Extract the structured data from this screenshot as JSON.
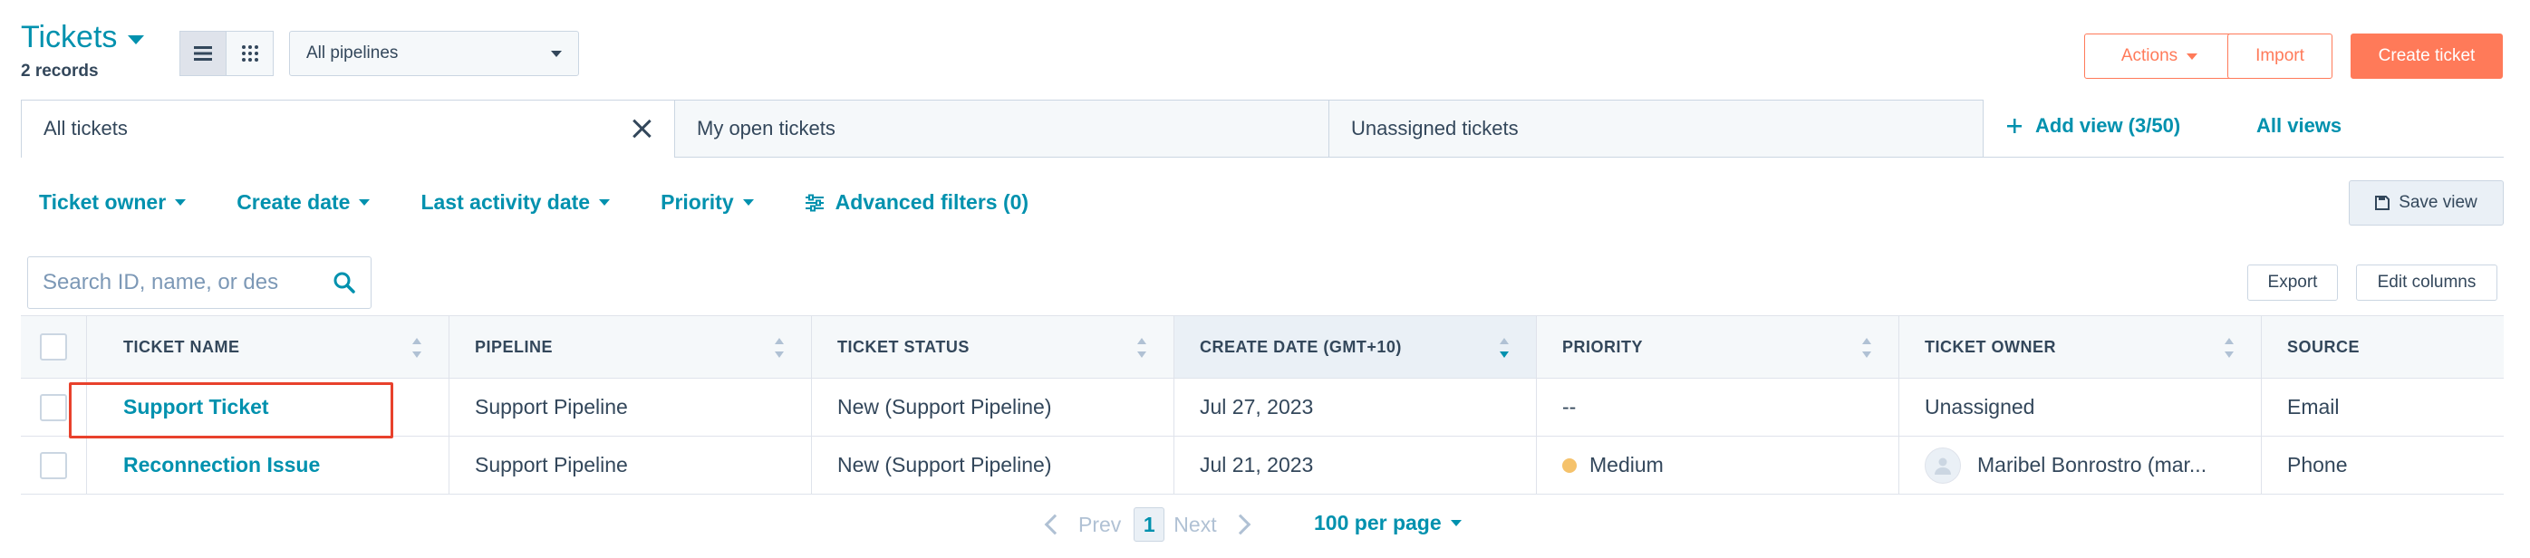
{
  "header": {
    "title": "Tickets",
    "record_count": "2 records",
    "pipeline_select": "All pipelines",
    "actions_label": "Actions",
    "import_label": "Import",
    "create_label": "Create ticket"
  },
  "tabs": [
    {
      "label": "All tickets",
      "active": true
    },
    {
      "label": "My open tickets",
      "active": false
    },
    {
      "label": "Unassigned tickets",
      "active": false
    }
  ],
  "views": {
    "add_view_label": "Add view (3/50)",
    "all_views_label": "All views"
  },
  "filters": {
    "items": [
      "Ticket owner",
      "Create date",
      "Last activity date",
      "Priority"
    ],
    "advanced_label": "Advanced filters (0)",
    "save_view_label": "Save view"
  },
  "toolbar": {
    "search_placeholder": "Search ID, name, or des",
    "export_label": "Export",
    "edit_columns_label": "Edit columns"
  },
  "table": {
    "columns": [
      "TICKET NAME",
      "PIPELINE",
      "TICKET STATUS",
      "CREATE DATE (GMT+10)",
      "PRIORITY",
      "TICKET OWNER",
      "SOURCE"
    ],
    "rows": [
      {
        "name": "Support Ticket",
        "pipeline": "Support Pipeline",
        "status": "New (Support Pipeline)",
        "create_date": "Jul 27, 2023",
        "priority": "--",
        "owner": "Unassigned",
        "source": "Email"
      },
      {
        "name": "Reconnection Issue",
        "pipeline": "Support Pipeline",
        "status": "New (Support Pipeline)",
        "create_date": "Jul 21, 2023",
        "priority": "Medium",
        "owner": "Maribel Bonrostro (mar...",
        "source": "Phone"
      }
    ]
  },
  "pagination": {
    "prev_label": "Prev",
    "current_page": "1",
    "next_label": "Next",
    "per_page_label": "100 per page"
  },
  "colors": {
    "accent": "#0091ae",
    "brand_orange": "#ff7a59",
    "highlight": "#e8412c",
    "priority_medium": "#f5c26b"
  }
}
